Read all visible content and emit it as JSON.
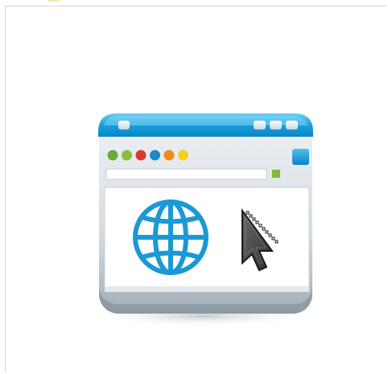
{
  "icon": {
    "name": "browser-window-icon",
    "subicons": [
      "globe-icon",
      "cursor-arrow-icon"
    ],
    "colors": {
      "title_bar": "#1aa0dc",
      "title_bar_light": "#5cc3ee",
      "window_body": "#dfe5ea",
      "window_body_dark": "#9ba7b0",
      "content_bg": "#ffffff",
      "globe": "#1a99d6",
      "cursor": "#4a4a4a",
      "address_bar": "#ffffff",
      "go_button": "#7dbb36",
      "side_button": "#1e9ede",
      "dots": [
        "#6aaa3a",
        "#8bbd3b",
        "#d83a2e",
        "#1d89c7",
        "#f28a1a",
        "#f3d21a"
      ]
    }
  }
}
